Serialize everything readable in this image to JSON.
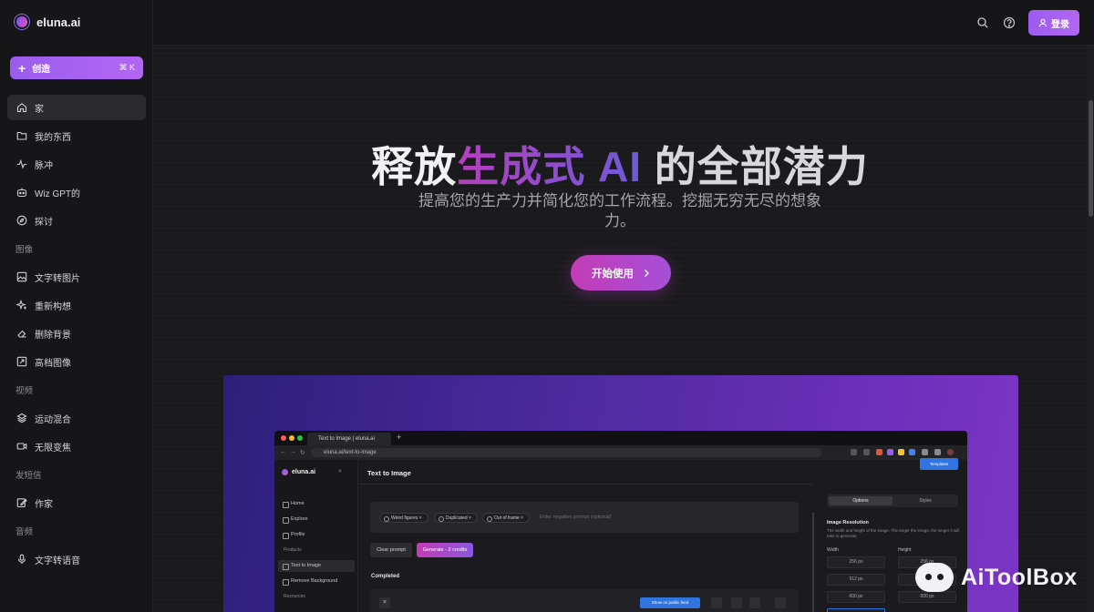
{
  "brand": {
    "name": "eluna.ai"
  },
  "sidebar": {
    "create": {
      "label": "创造",
      "shortcut": "⌘ K"
    },
    "items": [
      {
        "label": "家",
        "icon": "home-icon",
        "active": true
      },
      {
        "label": "我的东西",
        "icon": "folder-icon"
      },
      {
        "label": "脉冲",
        "icon": "pulse-icon"
      },
      {
        "label": "Wiz GPT的",
        "icon": "bot-icon"
      },
      {
        "label": "探讨",
        "icon": "compass-icon"
      }
    ],
    "sections": [
      {
        "label": "图像",
        "items": [
          {
            "label": "文字转图片",
            "icon": "image-icon"
          },
          {
            "label": "重新构想",
            "icon": "sparkle-icon"
          },
          {
            "label": "删除背景",
            "icon": "eraser-icon"
          },
          {
            "label": "高档图像",
            "icon": "upscale-icon"
          }
        ]
      },
      {
        "label": "视频",
        "items": [
          {
            "label": "运动混合",
            "icon": "layers-icon"
          },
          {
            "label": "无限变焦",
            "icon": "video-icon"
          }
        ]
      },
      {
        "label": "发短信",
        "items": [
          {
            "label": "作家",
            "icon": "pen-icon"
          }
        ]
      },
      {
        "label": "音频",
        "items": [
          {
            "label": "文字转语音",
            "icon": "mic-icon"
          }
        ]
      }
    ]
  },
  "topbar": {
    "login_label": "登录"
  },
  "hero": {
    "title_part1": "释放",
    "title_part2": "生成式 AI",
    "title_part3": " 的全部潜力",
    "subtitle": "提高您的生产力并简化您的工作流程。挖掘无穷无尽的想象力。",
    "cta_label": "开始使用"
  },
  "preview": {
    "tab_title": "Text to Image | eluna.ai",
    "url": "eluna.ai/text-to-image",
    "app_brand": "eluna.ai",
    "page_title": "Text to Image",
    "nav": [
      {
        "label": "Home"
      },
      {
        "label": "Explore"
      },
      {
        "label": "Profile"
      }
    ],
    "products_label": "Products",
    "products": [
      {
        "label": "Text to Image",
        "active": true
      },
      {
        "label": "Remove Background"
      }
    ],
    "resources_label": "Resources",
    "chips": [
      "Weird figures ×",
      "Duplicated ×",
      "Out of frame ×"
    ],
    "negative_placeholder": "Enter negative prompt (optional)",
    "clear_label": "Clear prompt",
    "generate_label": "Generate - 2 credits",
    "completed_label": "Completed",
    "show_public_label": "Show on public feed",
    "templates_label": "Templates",
    "options_tab": "Options",
    "styles_tab": "Styles",
    "resolution_title": "Image Resolution",
    "resolution_desc": "The width and height of the image. The larger the image, the longer it will take to generate.",
    "width_label": "Width",
    "height_label": "Height",
    "widths": [
      "256 px",
      "512 px",
      "600 px"
    ],
    "heights": [
      "256 px",
      "512 px",
      "600 px"
    ]
  },
  "watermark": {
    "text": "AiToolBox"
  },
  "colors": {
    "accent": "#a35cf0",
    "hero_gradient_start": "#b53fbf",
    "hero_gradient_end": "#6d5ad8"
  }
}
